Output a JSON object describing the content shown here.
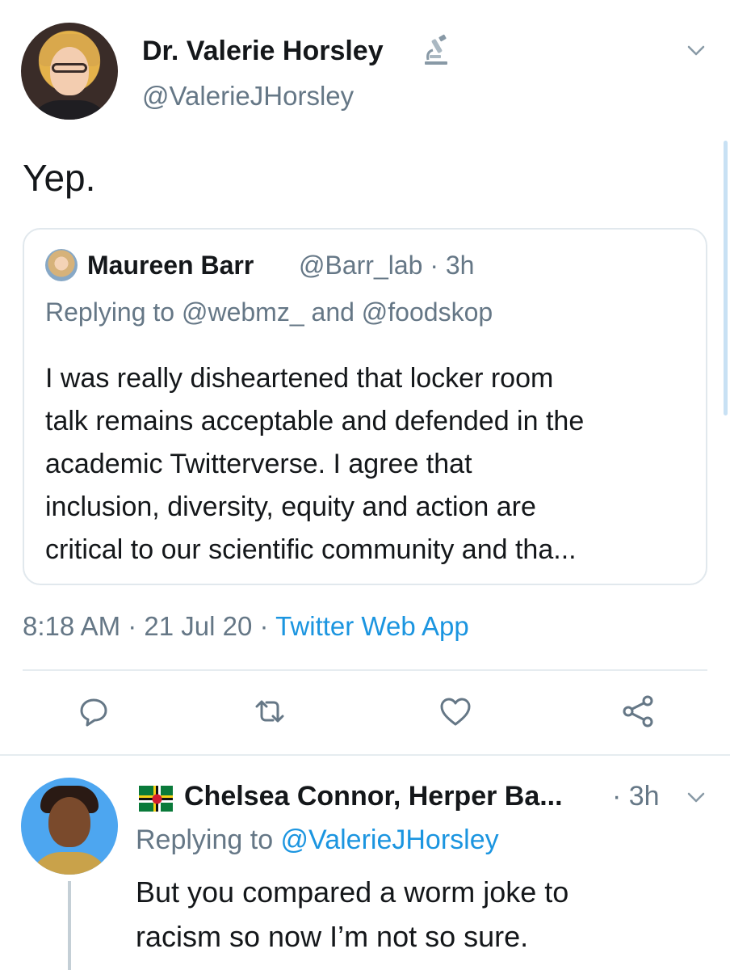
{
  "tweet": {
    "author": {
      "display_name": "Dr. Valerie Horsley",
      "name_icon": "microscope-icon",
      "handle": "@ValerieJHorsley"
    },
    "text": "Yep.",
    "quoted": {
      "display_name": "Maureen Barr",
      "handle": "@Barr_lab",
      "time": "3h",
      "replying_prefix": "Replying to",
      "replying_users": "@webmz_ and @foodskop",
      "body_lines": [
        "I was really disheartened that locker room",
        "talk remains acceptable and defended in the",
        "academic Twitterverse. I agree that",
        "inclusion, diversity, equity and action are",
        "critical to our scientific community and tha..."
      ]
    },
    "timestamp": "8:18 AM · 21 Jul 20 · ",
    "source": "Twitter Web App",
    "actions": [
      "reply-icon",
      "retweet-icon",
      "like-icon",
      "share-icon"
    ]
  },
  "reply": {
    "flag_icon": "dominica-flag-icon",
    "display_name": "Chelsea Connor, Herper Ba...",
    "time": "· 3h",
    "replying_prefix": "Replying to ",
    "replying_user": "@ValerieJHorsley",
    "body_lines": [
      "But you compared a worm joke to",
      "racism so now I’m not so sure."
    ]
  },
  "colors": {
    "link": "#1b95e0",
    "secondary_text": "#657786",
    "primary_text": "#14171a",
    "border": "#e1e8ed"
  }
}
